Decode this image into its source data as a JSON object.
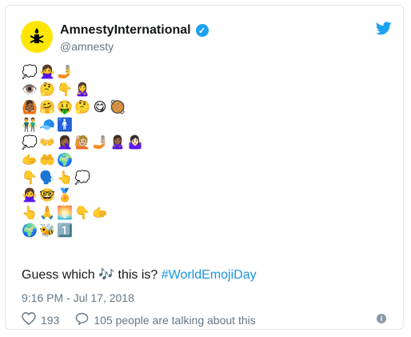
{
  "tweet": {
    "display_name": "AmnestyInternational",
    "handle": "@amnesty",
    "verified_mark": "✓",
    "text_before": "Guess which ",
    "inline_emoji": "🎶",
    "text_after": " this is? ",
    "hashtag": "#WorldEmojiDay",
    "timestamp": "9:16 PM - Jul 17, 2018",
    "likes": "193",
    "talking": "105 people are talking about this",
    "info_glyph": "i"
  },
  "emoji_rows": [
    [
      "💭",
      "🙅‍♀️",
      "🤳"
    ],
    [
      "👁️",
      "🤔",
      "👇",
      "🙎‍♀️"
    ],
    [
      "🙆🏾",
      "🤗",
      "🤑",
      "🤔",
      "😋",
      "🥘"
    ],
    [
      "👬",
      "🧢",
      "🚹"
    ],
    [
      "💭",
      "👐",
      "🤦🏾‍♀️",
      "🙋🏼",
      "🤳🏼",
      "🙎🏾‍♀️",
      "🤷🏻‍♀️"
    ],
    [
      "🫱",
      "🤲",
      "🌍"
    ],
    [
      "👇",
      "🗣️",
      "👆",
      "💭"
    ],
    [
      "🙅‍♀️",
      "🤓",
      "🏅"
    ],
    [
      "👆",
      "🙏",
      "🌅",
      "👇",
      "🫱"
    ],
    [
      "🌍",
      "🐝",
      "1️⃣"
    ]
  ],
  "icons": {
    "avatar": "candle-icon",
    "bird": "twitter-bird-icon",
    "heart": "heart-icon",
    "reply": "speech-bubble-icon",
    "info": "info-icon"
  },
  "colors": {
    "accent": "#1da1f2",
    "link": "#1b95e0",
    "avatar_bg": "#ffe600"
  }
}
